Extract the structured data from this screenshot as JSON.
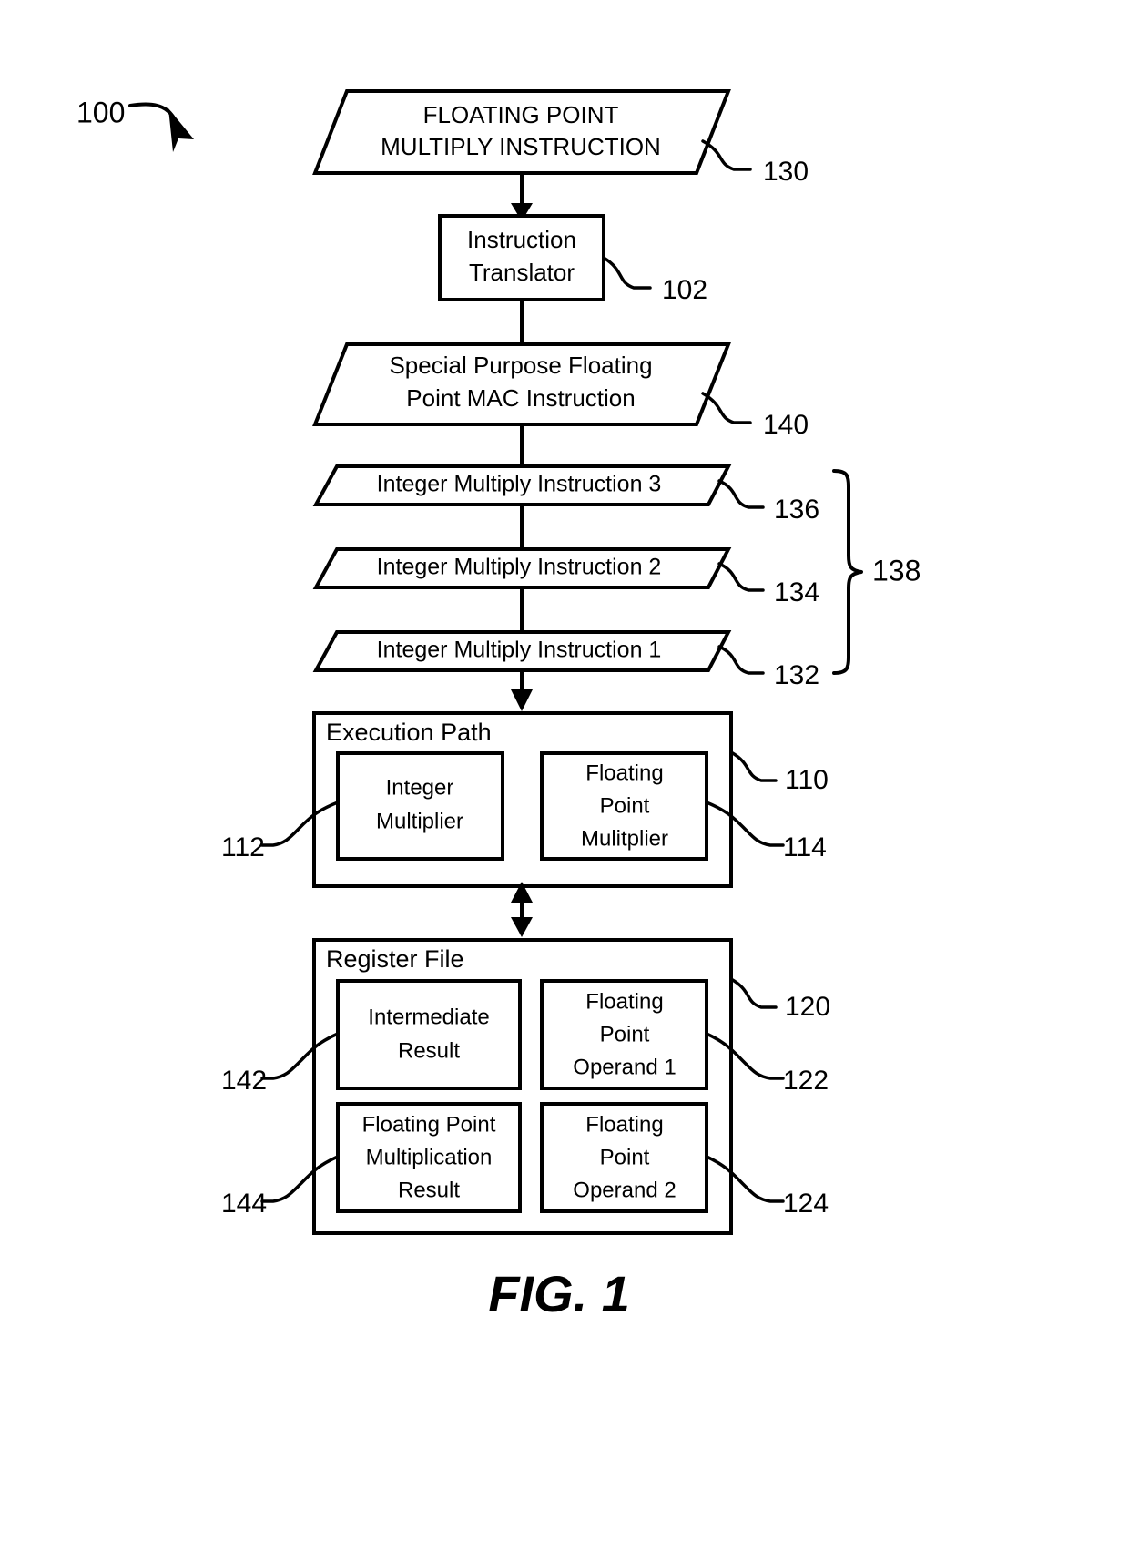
{
  "figure": {
    "caption": "FIG. 1",
    "system_ref": "100"
  },
  "nodes": {
    "fp_multiply_instruction": {
      "line1": "FLOATING POINT",
      "line2": "MULTIPLY INSTRUCTION",
      "ref": "130",
      "shape": "parallelogram"
    },
    "instruction_translator": {
      "line1": "Instruction",
      "line2": "Translator",
      "ref": "102",
      "shape": "rectangle"
    },
    "mac_instruction": {
      "line1": "Special Purpose Floating",
      "line2": "Point MAC Instruction",
      "ref": "140",
      "shape": "parallelogram"
    },
    "integer_multiply_3": {
      "label": "Integer Multiply Instruction 3",
      "ref": "136",
      "shape": "parallelogram"
    },
    "integer_multiply_2": {
      "label": "Integer Multiply Instruction 2",
      "ref": "134",
      "shape": "parallelogram"
    },
    "integer_multiply_1": {
      "label": "Integer Multiply Instruction 1",
      "ref": "132",
      "shape": "parallelogram"
    },
    "integer_instruction_group": {
      "ref": "138"
    },
    "execution_path": {
      "label": "Execution Path",
      "ref": "110",
      "shape": "rectangle",
      "children": {
        "integer_multiplier": {
          "line1": "Integer",
          "line2": "Multiplier",
          "ref": "112"
        },
        "floating_point_multiplier": {
          "line1": "Floating",
          "line2": "Point",
          "line3": "Mulitplier",
          "ref": "114"
        }
      }
    },
    "register_file": {
      "label": "Register File",
      "ref": "120",
      "shape": "rectangle",
      "children": {
        "intermediate_result": {
          "line1": "Intermediate",
          "line2": "Result",
          "ref": "142"
        },
        "floating_point_operand_1": {
          "line1": "Floating",
          "line2": "Point",
          "line3": "Operand 1",
          "ref": "122"
        },
        "floating_point_multiplication_result": {
          "line1": "Floating Point",
          "line2": "Multiplication",
          "line3": "Result",
          "ref": "144"
        },
        "floating_point_operand_2": {
          "line1": "Floating",
          "line2": "Point",
          "line3": "Operand 2",
          "ref": "124"
        }
      }
    }
  },
  "colors": {
    "stroke": "#000000",
    "background": "#ffffff"
  }
}
